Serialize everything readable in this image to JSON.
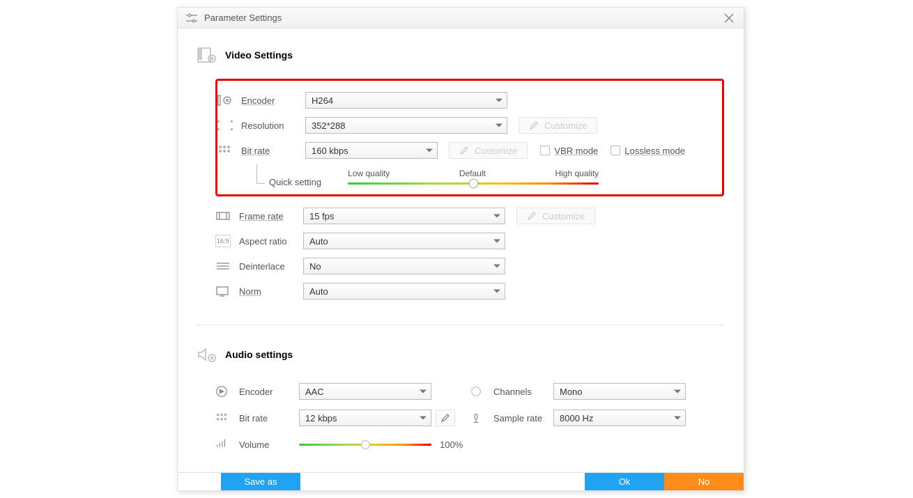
{
  "titlebar": {
    "title": "Parameter Settings"
  },
  "video": {
    "heading": "Video Settings",
    "encoder_label": "Encoder",
    "encoder_value": "H264",
    "resolution_label": "Resolution",
    "resolution_value": "352*288",
    "resolution_customize": "Customize",
    "bitrate_label": "Bit rate",
    "bitrate_value": "160 kbps",
    "bitrate_customize": "Customize",
    "vbr_label": "VBR mode",
    "lossless_label": "Lossless mode",
    "quick_setting": "Quick setting",
    "q_low": "Low quality",
    "q_default": "Default",
    "q_high": "High quality",
    "quality_percent": 50,
    "framerate_label": "Frame rate",
    "framerate_value": "15 fps",
    "framerate_customize": "Customize",
    "aspect_label": "Aspect ratio",
    "aspect_value": "Auto",
    "deinterlace_label": "Deinterlace",
    "deinterlace_value": "No",
    "norm_label": "Norm",
    "norm_value": "Auto"
  },
  "audio": {
    "heading": "Audio settings",
    "encoder_label": "Encoder",
    "encoder_value": "AAC",
    "channels_label": "Channels",
    "channels_value": "Mono",
    "bitrate_label": "Bit rate",
    "bitrate_value": "12 kbps",
    "samplerate_label": "Sample rate",
    "samplerate_value": "8000 Hz",
    "volume_label": "Volume",
    "volume_percent_label": "100%",
    "volume_slider_percent": 50
  },
  "footer": {
    "save": "Save as",
    "ok": "Ok",
    "no": "No"
  }
}
